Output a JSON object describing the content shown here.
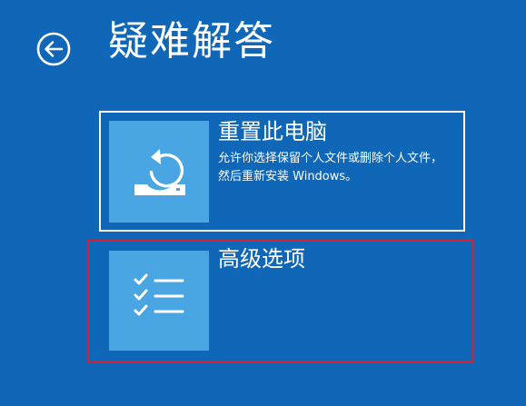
{
  "header": {
    "title": "疑难解答",
    "back_icon": "back-arrow-icon"
  },
  "options": [
    {
      "title": "重置此电脑",
      "description": "允许你选择保留个人文件或删除个人文件，然后重新安装 Windows。",
      "icon": "reset-pc-icon",
      "highlighted": false
    },
    {
      "title": "高级选项",
      "description": "",
      "icon": "checklist-icon",
      "highlighted": true
    }
  ],
  "colors": {
    "background": "#1067b7",
    "tile_icon_background": "#4aa6e3",
    "tile_border": "#ffffff",
    "highlight_border": "#d02233"
  }
}
